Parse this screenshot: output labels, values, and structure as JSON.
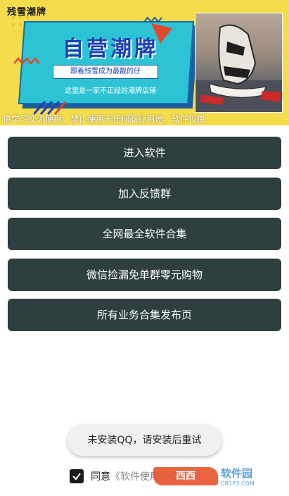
{
  "banner": {
    "brand": "残雪潮牌",
    "title": "自营潮牌",
    "subtitle": "跟着残雪成为最靓的仔",
    "note": "这里是一家不正经的潮牌店铺",
    "marquee": "供学习交流使用，禁止使用于任何商业用途，软件仅供"
  },
  "menu": {
    "items": [
      "进入软件",
      "加入反馈群",
      "全网最全软件合集",
      "微信捡漏免单群零元购物",
      "所有业务合集发布页"
    ]
  },
  "toast": {
    "text": "未安装QQ，请安装后重试"
  },
  "agreement": {
    "checked": true,
    "prefix": "同意",
    "link": "《软件使用协议》"
  },
  "watermark": {
    "badge": "西西",
    "title": "软件园",
    "url": "CR173.COM"
  },
  "colors": {
    "button_bg": "#2e3f3f",
    "banner_bg": "#f5dc4a",
    "card_bg": "#2cc4d4",
    "title_color": "#1d3fb8"
  }
}
